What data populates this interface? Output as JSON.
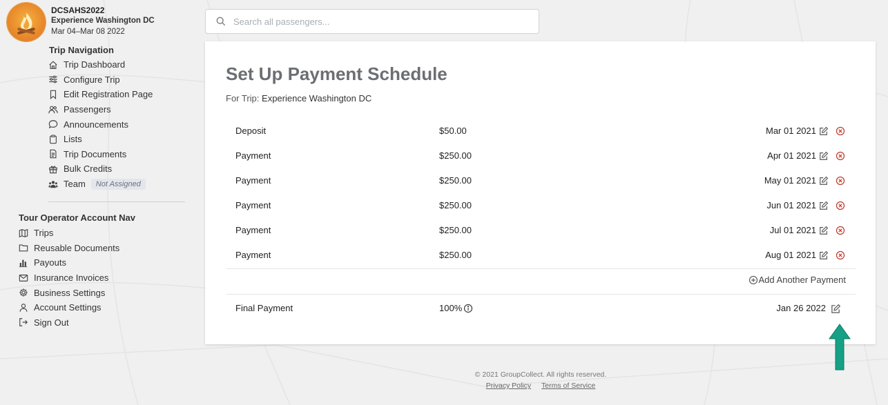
{
  "trip": {
    "code": "DCSAHS2022",
    "name": "Experience Washington DC",
    "dates": "Mar 04–Mar 08 2022"
  },
  "trip_nav": {
    "title": "Trip Navigation",
    "items": [
      {
        "label": "Trip Dashboard",
        "icon": "home-icon"
      },
      {
        "label": "Configure Trip",
        "icon": "sliders-icon"
      },
      {
        "label": "Edit Registration Page",
        "icon": "bookmark-icon"
      },
      {
        "label": "Passengers",
        "icon": "users-icon"
      },
      {
        "label": "Announcements",
        "icon": "chat-bubble-icon"
      },
      {
        "label": "Lists",
        "icon": "clipboard-icon"
      },
      {
        "label": "Trip Documents",
        "icon": "document-icon"
      },
      {
        "label": "Bulk Credits",
        "icon": "gift-icon"
      },
      {
        "label": "Team",
        "icon": "team-icon",
        "badge": "Not Assigned"
      }
    ]
  },
  "operator_nav": {
    "title": "Tour Operator Account Nav",
    "items": [
      {
        "label": "Trips",
        "icon": "map-icon"
      },
      {
        "label": "Reusable Documents",
        "icon": "folder-icon"
      },
      {
        "label": "Payouts",
        "icon": "bar-chart-icon"
      },
      {
        "label": "Insurance Invoices",
        "icon": "envelope-icon"
      },
      {
        "label": "Business Settings",
        "icon": "gear-icon"
      },
      {
        "label": "Account Settings",
        "icon": "user-icon"
      },
      {
        "label": "Sign Out",
        "icon": "sign-out-icon"
      }
    ]
  },
  "search": {
    "placeholder": "Search all passengers..."
  },
  "main": {
    "title": "Set Up Payment Schedule",
    "subtitle_prefix": "For Trip:",
    "subtitle_trip": "Experience Washington DC",
    "payments": [
      {
        "name": "Deposit",
        "amount": "$50.00",
        "date": "Mar 01 2021"
      },
      {
        "name": "Payment",
        "amount": "$250.00",
        "date": "Apr 01 2021"
      },
      {
        "name": "Payment",
        "amount": "$250.00",
        "date": "May 01 2021"
      },
      {
        "name": "Payment",
        "amount": "$250.00",
        "date": "Jun 01 2021"
      },
      {
        "name": "Payment",
        "amount": "$250.00",
        "date": "Jul 01 2021"
      },
      {
        "name": "Payment",
        "amount": "$250.00",
        "date": "Aug 01 2021"
      }
    ],
    "add_payment_label": "Add Another Payment",
    "final": {
      "name": "Final Payment",
      "amount": "100%",
      "date": "Jan 26 2022"
    }
  },
  "footer": {
    "copyright": "© 2021 GroupCollect. All rights reserved.",
    "privacy": "Privacy Policy",
    "terms": "Terms of Service"
  },
  "colors": {
    "delete_red": "#c0392b",
    "annotation_arrow": "#16a085",
    "title_gray": "#6b6f73"
  }
}
